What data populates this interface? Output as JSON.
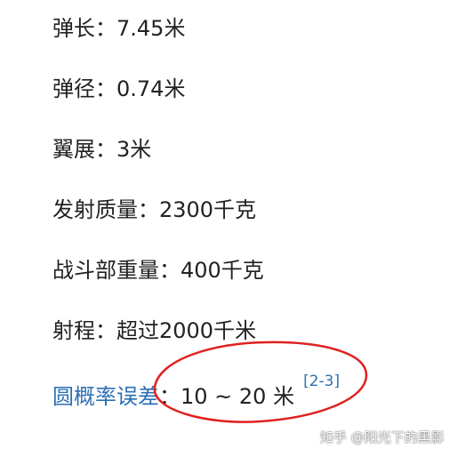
{
  "specs": [
    {
      "label": "弹长：",
      "value": "7.45米"
    },
    {
      "label": "弹径：",
      "value": "0.74米"
    },
    {
      "label": "翼展：",
      "value": "3米"
    },
    {
      "label": "发射质量：",
      "value": "2300千克"
    },
    {
      "label": "战斗部重量：",
      "value": "400千克"
    },
    {
      "label": "射程：",
      "value": "超过2000千米"
    }
  ],
  "cep": {
    "label": "圆概率误差",
    "separator": "：",
    "value": "10 ~ 20 米",
    "reference": "[2-3]",
    "link_color": "#2c6fb4"
  },
  "annotation": {
    "shape": "ellipse",
    "color": "#e02020"
  },
  "watermark": {
    "text": "知乎 @阳光下的黑影"
  }
}
